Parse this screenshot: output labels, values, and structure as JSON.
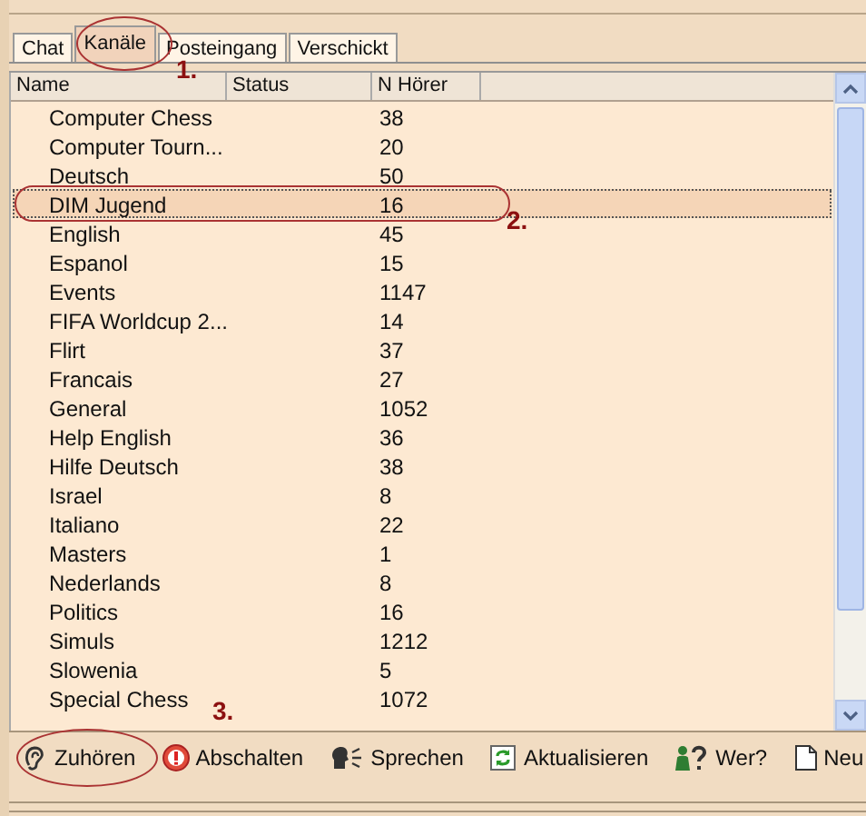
{
  "tabs": [
    {
      "label": "Chat",
      "selected": false
    },
    {
      "label": "Kanäle",
      "selected": true
    },
    {
      "label": "Posteingang",
      "selected": false
    },
    {
      "label": "Verschickt",
      "selected": false
    }
  ],
  "table": {
    "columns": [
      {
        "label": "Name"
      },
      {
        "label": "Status"
      },
      {
        "label": "N Hörer"
      }
    ],
    "rows": [
      {
        "name": "Computer Chess",
        "listeners": "38",
        "selected": false
      },
      {
        "name": "Computer Tourn...",
        "listeners": "20",
        "selected": false
      },
      {
        "name": "Deutsch",
        "listeners": "50",
        "selected": false
      },
      {
        "name": "DIM Jugend",
        "listeners": "16",
        "selected": true
      },
      {
        "name": "English",
        "listeners": "45",
        "selected": false
      },
      {
        "name": "Espanol",
        "listeners": "15",
        "selected": false
      },
      {
        "name": "Events",
        "listeners": "1147",
        "selected": false
      },
      {
        "name": "FIFA Worldcup 2...",
        "listeners": "14",
        "selected": false
      },
      {
        "name": "Flirt",
        "listeners": "37",
        "selected": false
      },
      {
        "name": "Francais",
        "listeners": "27",
        "selected": false
      },
      {
        "name": "General",
        "listeners": "1052",
        "selected": false
      },
      {
        "name": "Help English",
        "listeners": "36",
        "selected": false
      },
      {
        "name": "Hilfe Deutsch",
        "listeners": "38",
        "selected": false
      },
      {
        "name": "Israel",
        "listeners": "8",
        "selected": false
      },
      {
        "name": "Italiano",
        "listeners": "22",
        "selected": false
      },
      {
        "name": "Masters",
        "listeners": "1",
        "selected": false
      },
      {
        "name": "Nederlands",
        "listeners": "8",
        "selected": false
      },
      {
        "name": "Politics",
        "listeners": "16",
        "selected": false
      },
      {
        "name": "Simuls",
        "listeners": "1212",
        "selected": false
      },
      {
        "name": "Slowenia",
        "listeners": "5",
        "selected": false
      },
      {
        "name": "Special Chess",
        "listeners": "1072",
        "selected": false
      }
    ]
  },
  "toolbar": [
    {
      "kind": "ear",
      "label": "Zuhören"
    },
    {
      "kind": "power",
      "label": "Abschalten"
    },
    {
      "kind": "speak",
      "label": "Sprechen"
    },
    {
      "kind": "refresh",
      "label": "Aktualisieren"
    },
    {
      "kind": "who",
      "label": "Wer?"
    },
    {
      "kind": "new",
      "label": "Neu"
    }
  ],
  "annotations": [
    {
      "label": "1."
    },
    {
      "label": "2."
    },
    {
      "label": "3."
    }
  ]
}
